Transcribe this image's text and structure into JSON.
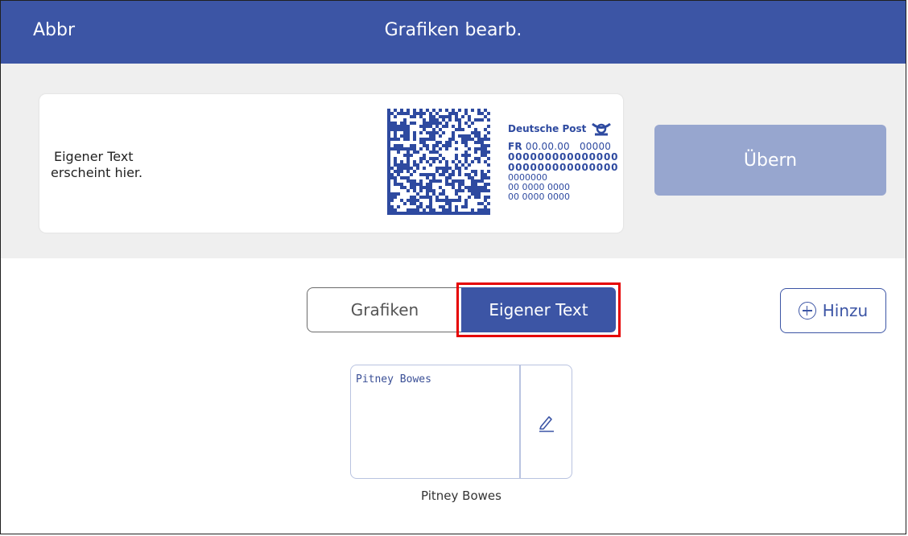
{
  "header": {
    "back_label": "Abbr",
    "title": "Grafiken bearb."
  },
  "preview": {
    "custom_text_line1": "Eigener Text",
    "custom_text_line2": "erscheint hier.",
    "stamp": {
      "brand": "Deutsche Post",
      "fr_prefix": "FR",
      "fr_values": "00.00.00   00000",
      "bold_line1": "000000000000000",
      "bold_line2": "000000000000000",
      "small_line1": "0000000",
      "small_line2": "00 0000 0000",
      "small_line3": "00 0000 0000"
    },
    "accept_label": "Übern"
  },
  "tabs": {
    "graphics_label": "Grafiken",
    "custom_text_label": "Eigener Text",
    "active": "custom_text"
  },
  "add_button": {
    "label": "Hinzu",
    "icon": "plus-circle-icon"
  },
  "items": [
    {
      "content": "Pitney Bowes",
      "caption": "Pitney Bowes",
      "edit_icon": "pencil-icon"
    }
  ],
  "colors": {
    "header_bg": "#3c55a5",
    "accent": "#3c55a5",
    "accept_disabled": "#97a6cf",
    "highlight_outline": "#e60000"
  }
}
